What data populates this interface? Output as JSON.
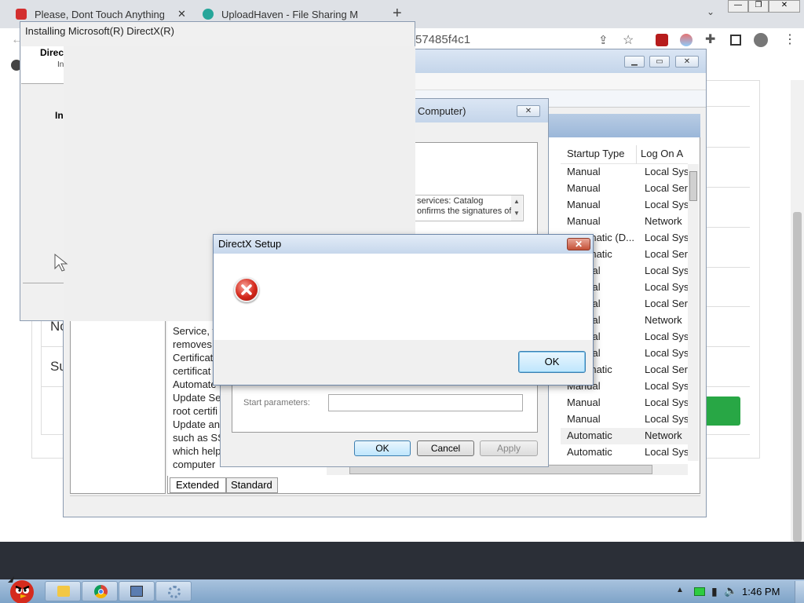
{
  "browser": {
    "tabs": [
      {
        "title": "Please, Dont Touch Anything I",
        "close": "✕"
      },
      {
        "title": "UploadHaven - File Sharing M",
        "close": "✕"
      }
    ],
    "new_tab": "+",
    "url_fragment": "57485f4c1",
    "window_controls": {
      "minimize": "—",
      "restore": "❐",
      "close": "✕"
    }
  },
  "page": {
    "left_labels": [
      "No",
      "Su"
    ]
  },
  "services_window": {
    "columns": {
      "startup_type": "Startup Type",
      "log_on_as": "Log On A"
    },
    "rows": [
      {
        "startup": "Manual",
        "logon": "Local Sys"
      },
      {
        "startup": "Manual",
        "logon": "Local Ser"
      },
      {
        "startup": "Manual",
        "logon": "Local Sys"
      },
      {
        "startup": "Manual",
        "logon": "Network"
      },
      {
        "startup": "Automatic (D...",
        "logon": "Local Sys"
      },
      {
        "startup": "Automatic",
        "logon": "Local Ser"
      },
      {
        "startup": "Manual",
        "logon": "Local Sys"
      },
      {
        "startup": "Manual",
        "logon": "Local Sys"
      },
      {
        "startup": "Manual",
        "logon": "Local Ser"
      },
      {
        "startup": "Manual",
        "logon": "Network"
      },
      {
        "startup": "Manual",
        "logon": "Local Sys"
      },
      {
        "startup": "Manual",
        "logon": "Local Sys"
      },
      {
        "startup": "Automatic",
        "logon": "Local Ser"
      },
      {
        "startup": "Manual",
        "logon": "Local Sys"
      },
      {
        "startup": "Manual",
        "logon": "Local Sys"
      },
      {
        "startup": "Manual",
        "logon": "Local Sys"
      },
      {
        "startup": "Automatic",
        "logon": "Network"
      },
      {
        "startup": "Automatic",
        "logon": "Local Sys"
      }
    ],
    "description_lines": [
      "Service, w",
      "removes",
      "Certificat",
      "certificat",
      "Automate",
      "Update Se",
      "root certifi",
      "Update an",
      "such as SS",
      "which help",
      "computer"
    ],
    "tabs": {
      "extended": "Extended",
      "standard": "Standard"
    }
  },
  "properties_dialog": {
    "title_fragment": "Computer)",
    "description": "services: Catalog\nonfirms the signatures of",
    "start_parameters_label": "Start parameters:",
    "start_parameters_value": "",
    "ok": "OK",
    "cancel": "Cancel",
    "apply": "Apply"
  },
  "directx_install": {
    "title": "Installing Microsoft(R) DirectX(R)",
    "heading_fragment": "Direc",
    "sub_fragment": "In",
    "body_fragment": "In"
  },
  "error_dialog": {
    "title": "DirectX Setup",
    "close": "✕",
    "message": "",
    "ok": "OK"
  },
  "taskbar": {
    "time": "1:46 PM"
  },
  "colors": {
    "accent_green": "#28a745",
    "error_red": "#d4281b"
  }
}
